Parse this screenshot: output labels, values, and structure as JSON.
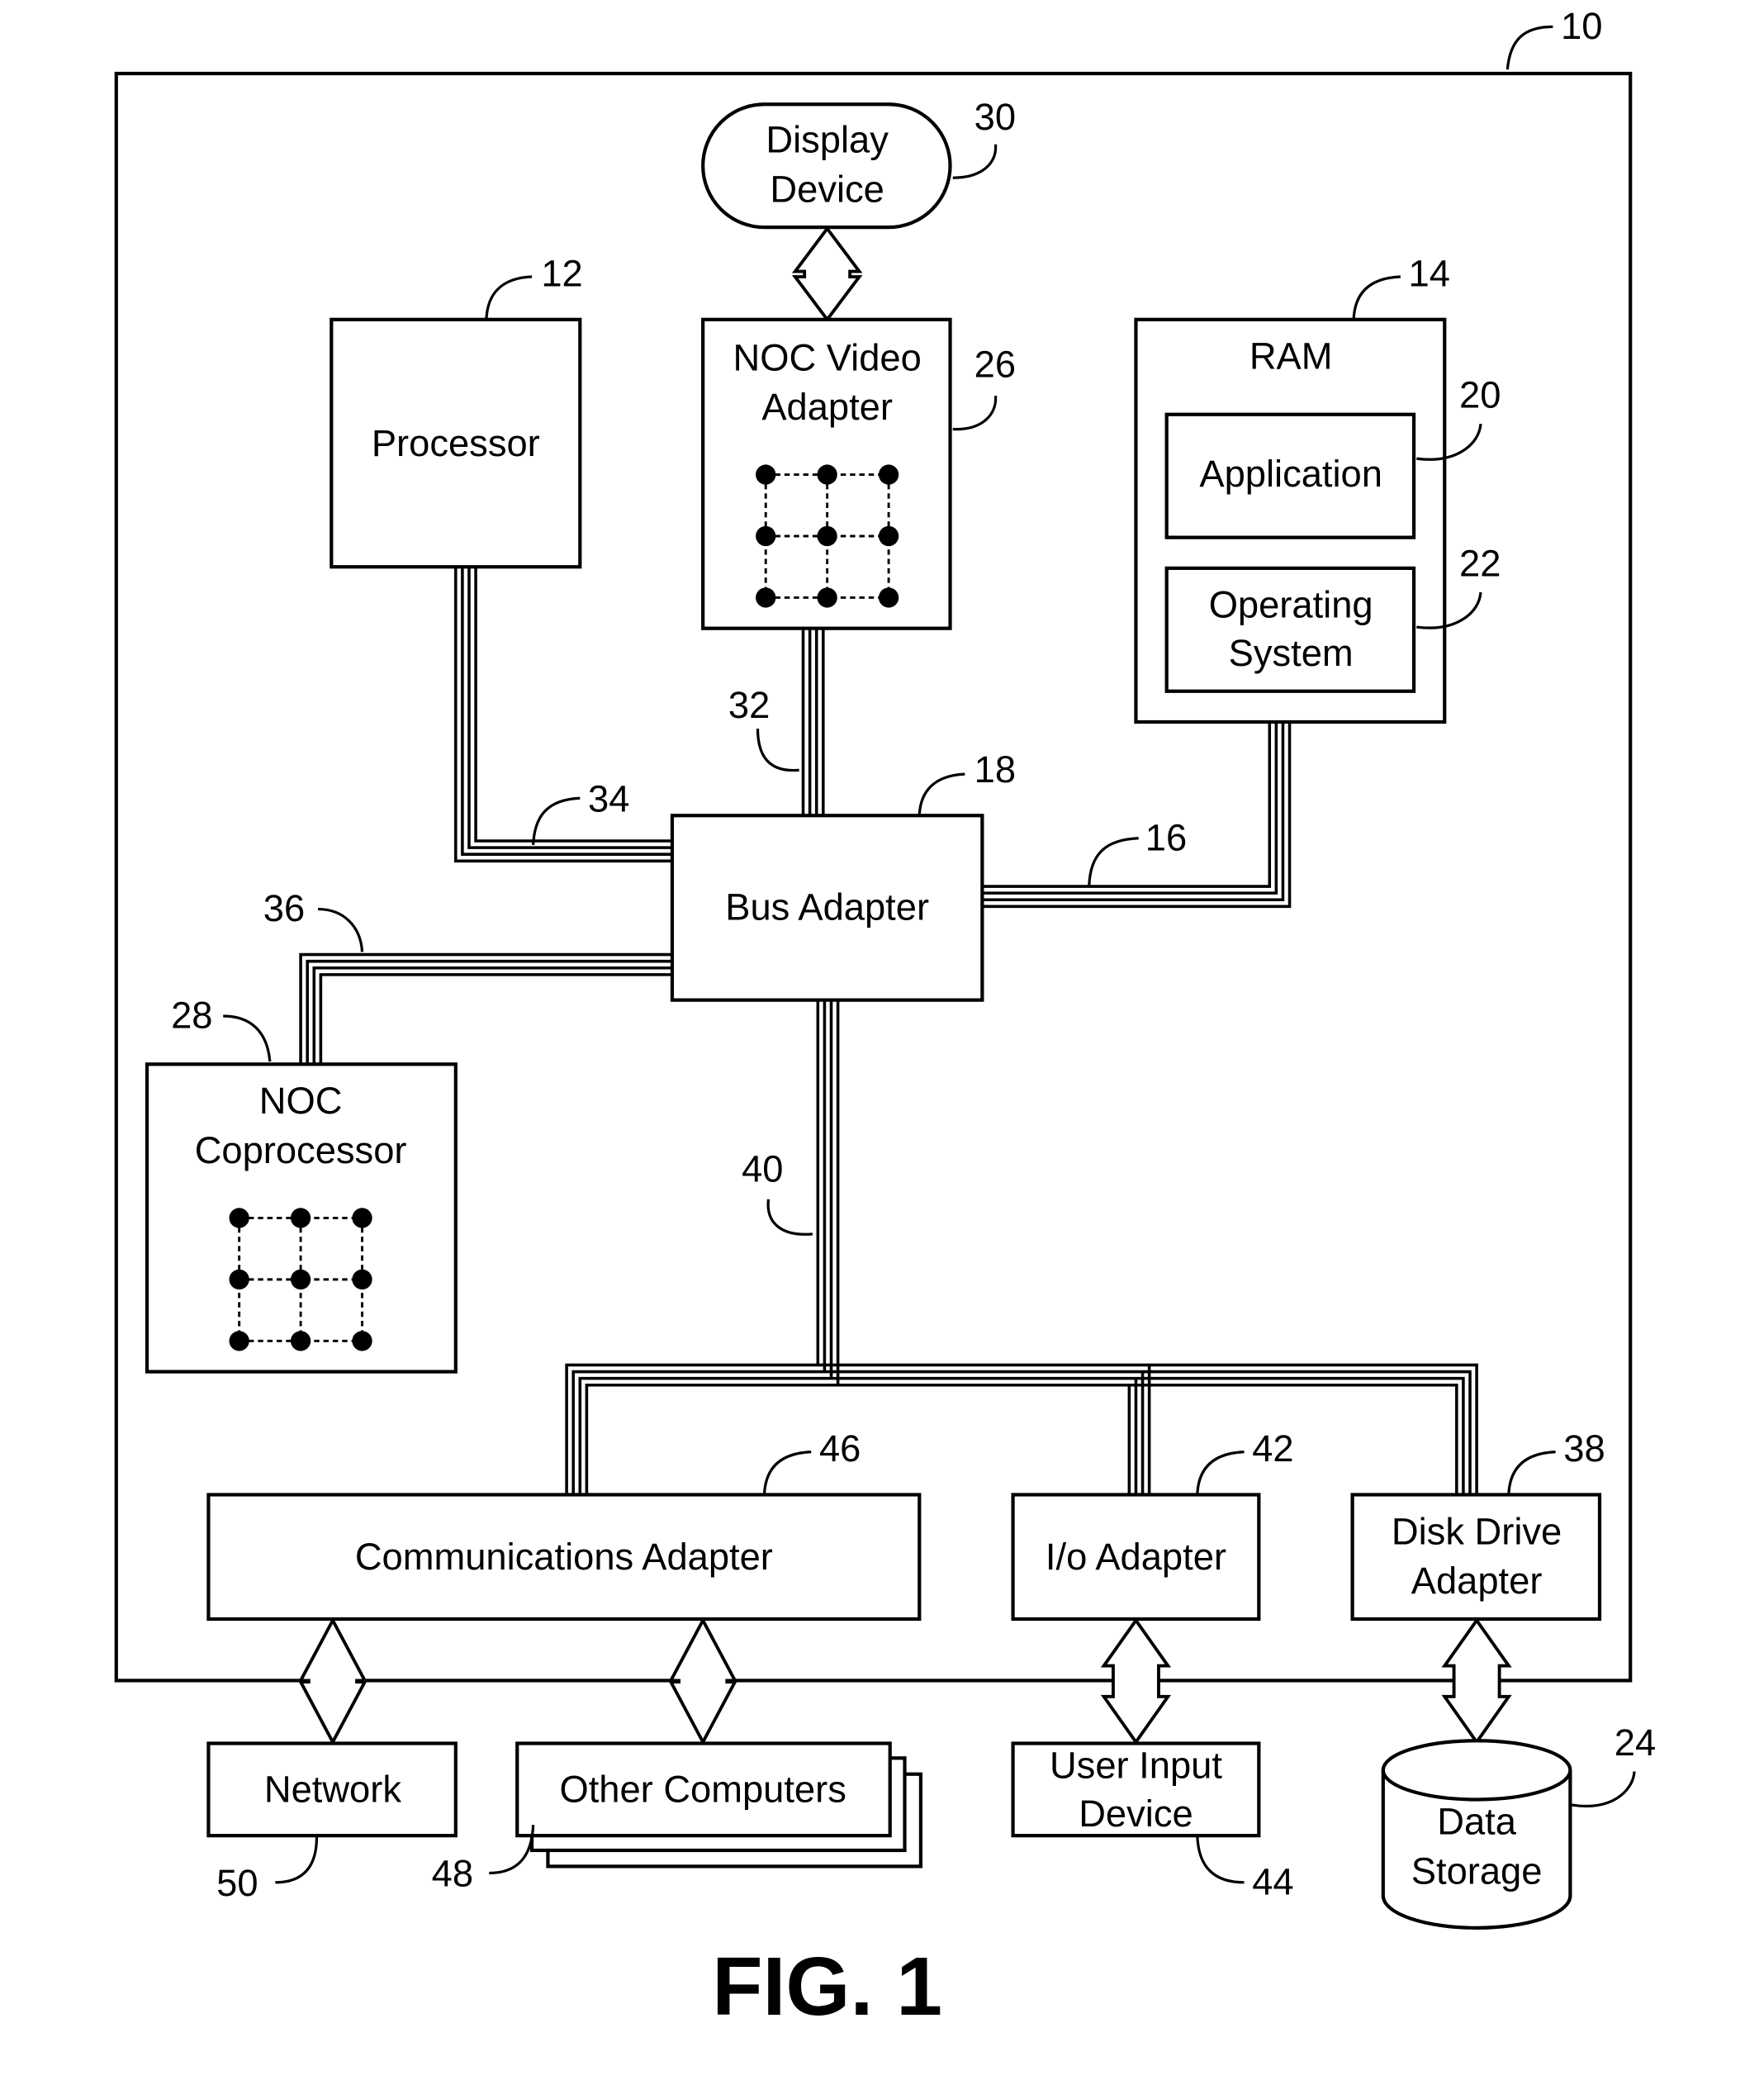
{
  "figure": {
    "title": "FIG. 1",
    "system_ref": "10"
  },
  "components": {
    "display_device": {
      "label_lines": [
        "Display",
        "Device"
      ],
      "ref": "30"
    },
    "processor": {
      "label_lines": [
        "Processor"
      ],
      "ref": "12"
    },
    "noc_video_adapter": {
      "label_lines": [
        "NOC Video",
        "Adapter"
      ],
      "ref": "26"
    },
    "ram": {
      "label_lines": [
        "RAM"
      ],
      "ref": "14"
    },
    "application": {
      "label_lines": [
        "Application"
      ],
      "ref": "20"
    },
    "operating_system": {
      "label_lines": [
        "Operating",
        "System"
      ],
      "ref": "22"
    },
    "bus_adapter": {
      "label_lines": [
        "Bus Adapter"
      ],
      "ref": "18"
    },
    "noc_coprocessor": {
      "label_lines": [
        "NOC",
        "Coprocessor"
      ],
      "ref": "28"
    },
    "communications_adapter": {
      "label_lines": [
        "Communications Adapter"
      ],
      "ref": "46"
    },
    "io_adapter": {
      "label_lines": [
        "I/o Adapter"
      ],
      "ref": "42"
    },
    "disk_drive_adapter": {
      "label_lines": [
        "Disk Drive",
        "Adapter"
      ],
      "ref": "38"
    },
    "network": {
      "label_lines": [
        "Network"
      ],
      "ref": "50"
    },
    "other_computers": {
      "label_lines": [
        "Other Computers"
      ],
      "ref": "48"
    },
    "user_input_device": {
      "label_lines": [
        "User Input",
        "Device"
      ],
      "ref": "44"
    },
    "data_storage": {
      "label_lines": [
        "Data",
        "Storage"
      ],
      "ref": "24"
    }
  },
  "buses": {
    "video_bus": {
      "ref": "32"
    },
    "front_side_bus": {
      "ref": "34"
    },
    "memory_bus": {
      "ref": "16"
    },
    "coprocessor_bus": {
      "ref": "36"
    },
    "expansion_bus": {
      "ref": "40"
    }
  }
}
